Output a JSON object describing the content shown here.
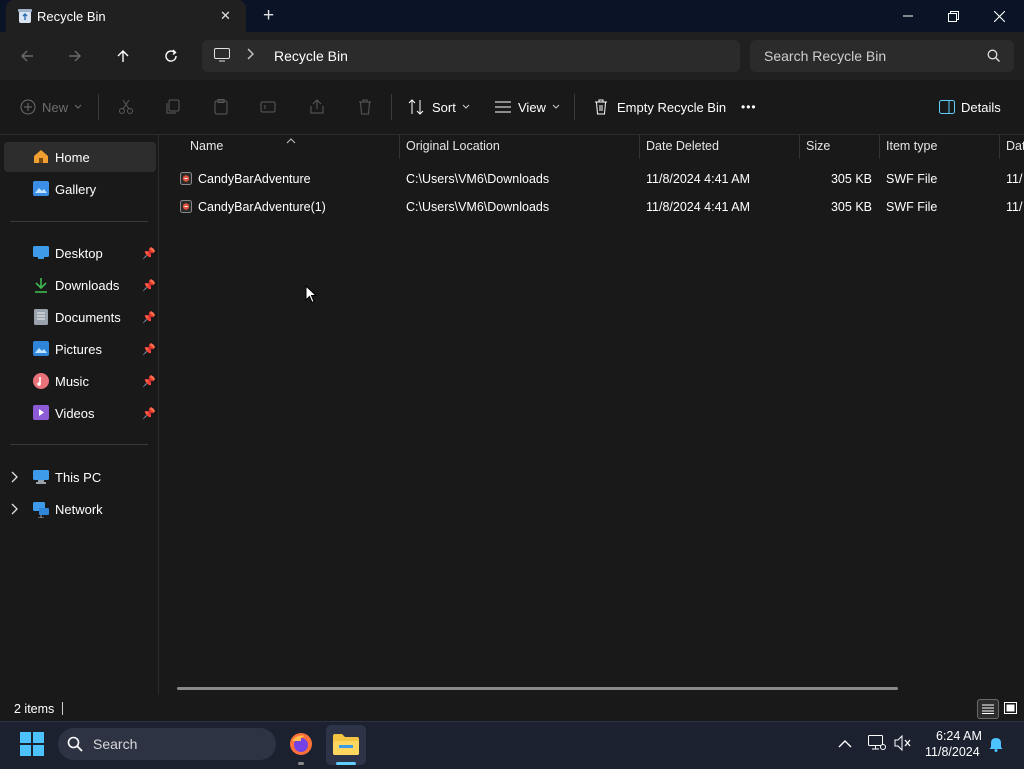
{
  "window": {
    "tab_title": "Recycle Bin",
    "new_tab_glyph": "+",
    "close_tab_glyph": "✕"
  },
  "address": {
    "location": "Recycle Bin",
    "search_placeholder": "Search Recycle Bin"
  },
  "toolbar": {
    "new_label": "New",
    "sort_label": "Sort",
    "view_label": "View",
    "empty_label": "Empty Recycle Bin",
    "more_label": "•••",
    "details_label": "Details"
  },
  "sidebar": {
    "top_items": [
      {
        "label": "Home",
        "icon": "home-icon"
      },
      {
        "label": "Gallery",
        "icon": "gallery-icon"
      }
    ],
    "pinned_items": [
      {
        "label": "Desktop",
        "icon": "desktop-icon"
      },
      {
        "label": "Downloads",
        "icon": "downloads-icon"
      },
      {
        "label": "Documents",
        "icon": "documents-icon"
      },
      {
        "label": "Pictures",
        "icon": "pictures-icon"
      },
      {
        "label": "Music",
        "icon": "music-icon"
      },
      {
        "label": "Videos",
        "icon": "videos-icon"
      }
    ],
    "bottom_items": [
      {
        "label": "This PC",
        "icon": "this-pc-icon"
      },
      {
        "label": "Network",
        "icon": "network-icon"
      }
    ]
  },
  "columns": {
    "name": "Name",
    "original_location": "Original Location",
    "date_deleted": "Date Deleted",
    "size": "Size",
    "item_type": "Item type",
    "date_modified_partial": "Dat"
  },
  "files": [
    {
      "name": "CandyBarAdventure",
      "original_location": "C:\\Users\\VM6\\Downloads",
      "date_deleted": "11/8/2024 4:41 AM",
      "size": "305 KB",
      "item_type": "SWF File",
      "date_modified_partial": "11/"
    },
    {
      "name": "CandyBarAdventure(1)",
      "original_location": "C:\\Users\\VM6\\Downloads",
      "date_deleted": "11/8/2024 4:41 AM",
      "size": "305 KB",
      "item_type": "SWF File",
      "date_modified_partial": "11/"
    }
  ],
  "status": {
    "item_count": "2 items"
  },
  "taskbar": {
    "search_label": "Search",
    "time": "6:24 AM",
    "date": "11/8/2024"
  },
  "colors": {
    "accent": "#60cdff",
    "folder_yellow": "#f4c542",
    "background": "#191919"
  }
}
